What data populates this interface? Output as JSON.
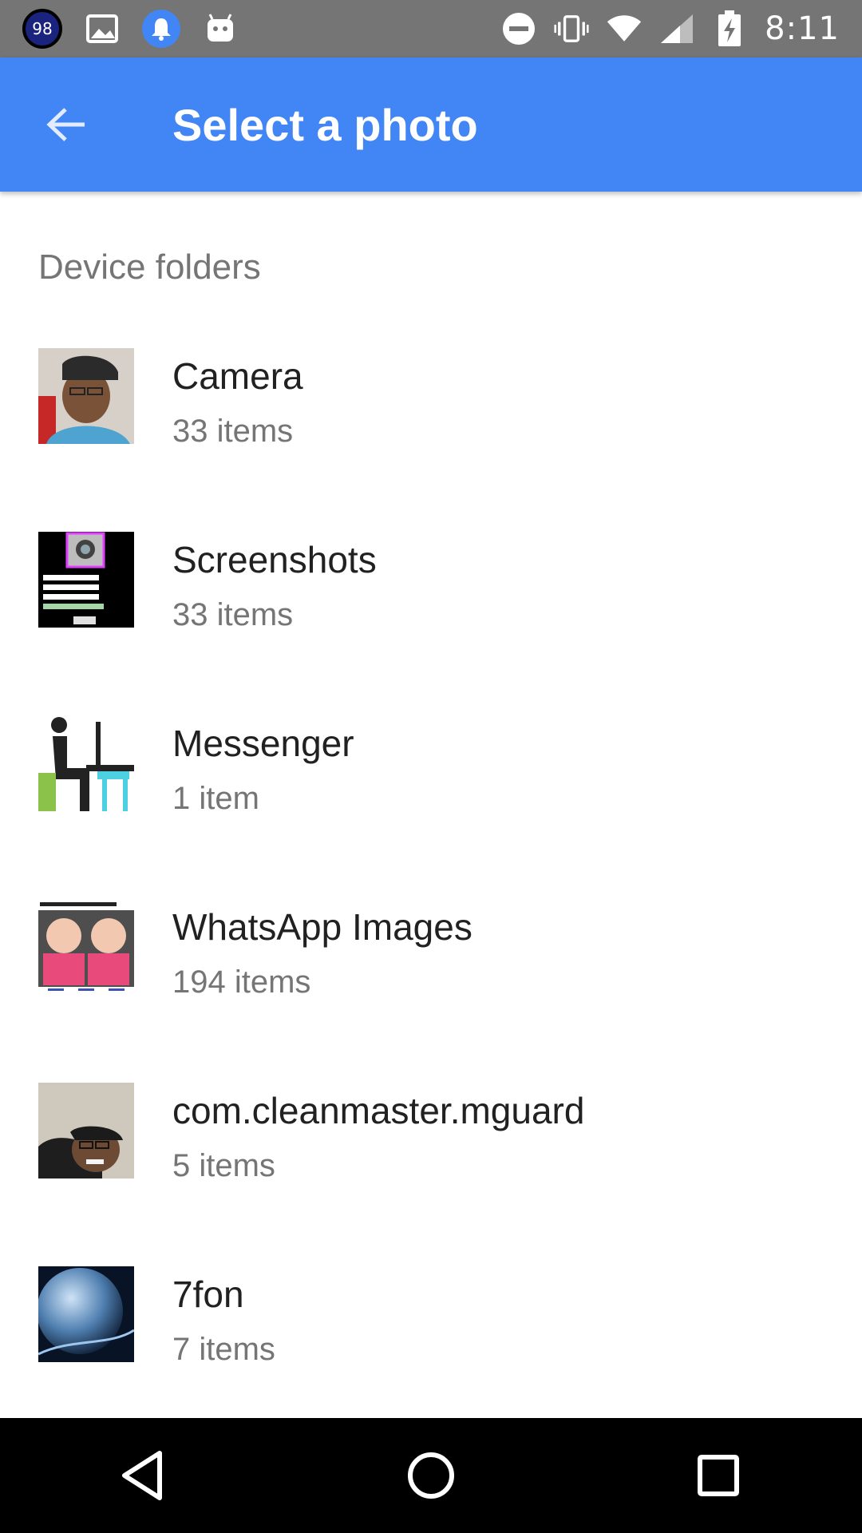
{
  "status_bar": {
    "battery_badge": "98",
    "time": "8:11",
    "icons": [
      "battery-ring-icon",
      "image-icon",
      "notification-bell-icon",
      "android-icon",
      "do-not-disturb-icon",
      "vibrate-icon",
      "wifi-icon",
      "cell-signal-icon",
      "battery-charging-icon"
    ]
  },
  "app_bar": {
    "title": "Select a photo",
    "back_icon": "arrow-back-icon"
  },
  "section": {
    "header": "Device folders"
  },
  "folders": [
    {
      "name": "Camera",
      "count": "33 items"
    },
    {
      "name": "Screenshots",
      "count": "33 items"
    },
    {
      "name": "Messenger",
      "count": "1 item"
    },
    {
      "name": "WhatsApp Images",
      "count": "194 items"
    },
    {
      "name": "com.cleanmaster.mguard",
      "count": "5 items"
    },
    {
      "name": "7fon",
      "count": "7 items"
    }
  ],
  "nav_bar": {
    "icons": [
      "back-triangle-icon",
      "home-circle-icon",
      "recents-square-icon"
    ]
  },
  "colors": {
    "app_bar": "#4285f4",
    "status_bar": "#757575",
    "nav_bar": "#000000"
  }
}
